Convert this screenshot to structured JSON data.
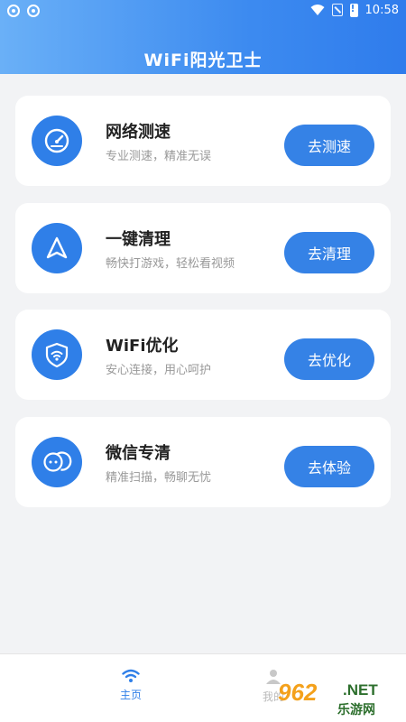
{
  "status_bar": {
    "time": "10:58"
  },
  "header": {
    "title": "WiFi阳光卫士"
  },
  "cards": [
    {
      "title": "网络测速",
      "subtitle": "专业测速，精准无误",
      "button": "去测速",
      "icon": "speedometer-icon"
    },
    {
      "title": "一键清理",
      "subtitle": "畅快打游戏，轻松看视频",
      "button": "去清理",
      "icon": "navigation-arrow-icon"
    },
    {
      "title": "WiFi优化",
      "subtitle": "安心连接，用心呵护",
      "button": "去优化",
      "icon": "wifi-shield-icon"
    },
    {
      "title": "微信专清",
      "subtitle": "精准扫描，畅聊无忧",
      "button": "去体验",
      "icon": "wechat-icon"
    }
  ],
  "tabbar": {
    "home_label": "主页",
    "mine_label": "我的"
  },
  "watermark": {
    "number": "962",
    "net": ".NET",
    "sub": "乐游网"
  },
  "colors": {
    "accent": "#3582e6",
    "header_start": "#6ab0f7",
    "header_end": "#2f7cec",
    "background": "#f2f3f5"
  }
}
